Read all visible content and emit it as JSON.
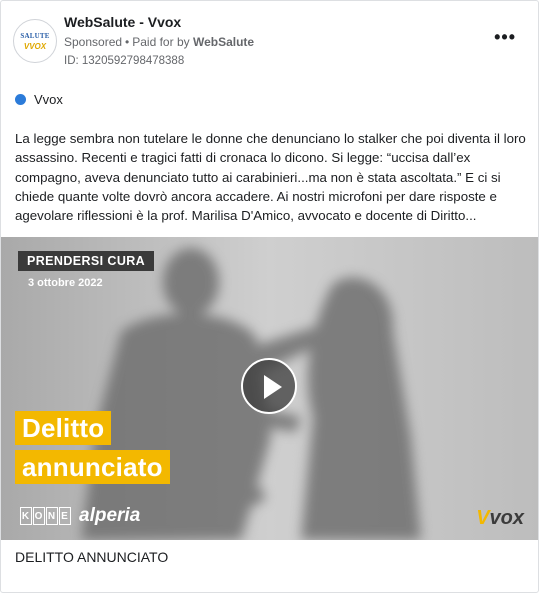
{
  "post": {
    "page_name": "WebSalute - Vvox",
    "sponsored_label": "Sponsored",
    "paid_for_prefix": "Paid for by",
    "paid_for_by": "WebSalute",
    "ad_id": "ID: 1320592798478388",
    "more_icon": "•••",
    "avatar": {
      "line1": "SALUTE",
      "line2": "VVOX"
    },
    "platform_label": "Vvox",
    "platform_color": "#2b7bd9",
    "body": "La legge sembra non tutelare le donne che denunciano lo stalker che poi diventa il loro assassino. Recenti e tragici fatti di cronaca lo dicono. Si legge: “uccisa dall’ex compagno, aveva denunciato tutto ai carabinieri...ma non è stata ascoltata.” E ci si chiede quante volte dovrò ancora accadere. Ai nostri microfoni per dare risposte e agevolare riflessioni è la prof. Marilisa D'Amico, avvocato e docente di Diritto...",
    "caption": "DELITTO ANNUNCIATO"
  },
  "media": {
    "tag": "PRENDERSI CURA",
    "date": "3 ottobre 2022",
    "title_line1": "Delitto",
    "title_line2": "annunciato",
    "sponsor1": "KONE",
    "sponsor2": "alperia",
    "logo_part1": "V",
    "logo_part2": "vox",
    "accent_color": "#f3b800"
  }
}
